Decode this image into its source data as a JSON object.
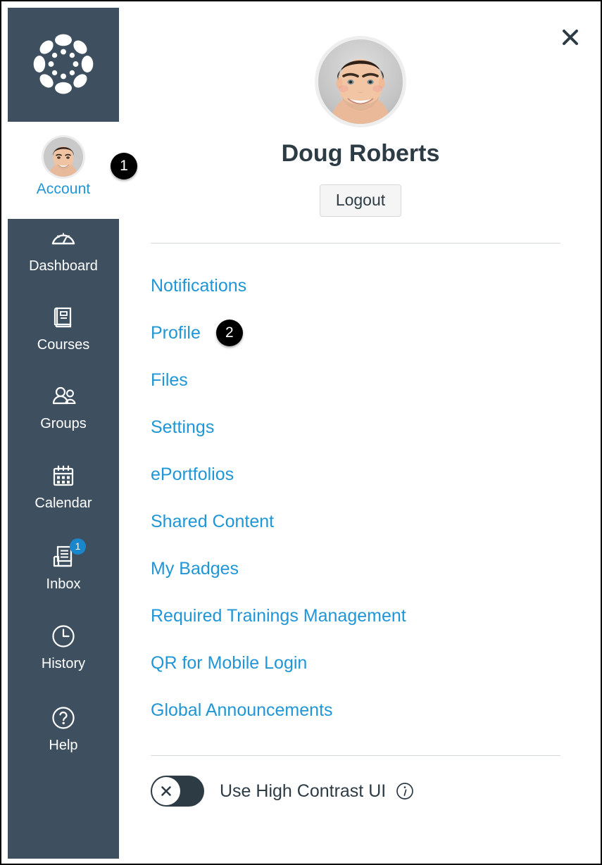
{
  "colors": {
    "nav_background": "#3E5060",
    "link_blue": "#2196D6",
    "text_dark": "#2D3B45",
    "badge_blue": "#1A86CB",
    "callout_black": "#000000",
    "divider": "#d6dadc"
  },
  "global_nav": {
    "logo_name": "canvas-logo",
    "account": {
      "label": "Account",
      "avatar_alt": "Doug Roberts",
      "callout": "1"
    },
    "items": [
      {
        "label": "Dashboard",
        "icon": "dashboard-icon",
        "badge": null
      },
      {
        "label": "Courses",
        "icon": "courses-icon",
        "badge": null
      },
      {
        "label": "Groups",
        "icon": "groups-icon",
        "badge": null
      },
      {
        "label": "Calendar",
        "icon": "calendar-icon",
        "badge": null
      },
      {
        "label": "Inbox",
        "icon": "inbox-icon",
        "badge": "1"
      },
      {
        "label": "History",
        "icon": "history-icon",
        "badge": null
      },
      {
        "label": "Help",
        "icon": "help-icon",
        "badge": null
      }
    ]
  },
  "tray": {
    "close_label": "Close",
    "close_icon": "close-icon",
    "user_name": "Doug Roberts",
    "avatar_alt": "Doug Roberts profile picture",
    "logout_label": "Logout",
    "links": [
      {
        "label": "Notifications",
        "callout": null
      },
      {
        "label": "Profile",
        "callout": "2"
      },
      {
        "label": "Files",
        "callout": null
      },
      {
        "label": "Settings",
        "callout": null
      },
      {
        "label": "ePortfolios",
        "callout": null
      },
      {
        "label": "Shared Content",
        "callout": null
      },
      {
        "label": "My Badges",
        "callout": null
      },
      {
        "label": "Required Trainings Management",
        "callout": null
      },
      {
        "label": "QR for Mobile Login",
        "callout": null
      },
      {
        "label": "Global Announcements",
        "callout": null
      }
    ],
    "high_contrast": {
      "label": "Use High Contrast UI",
      "state": "off",
      "toggle_icon": "x-icon",
      "info_icon": "info-icon"
    }
  }
}
